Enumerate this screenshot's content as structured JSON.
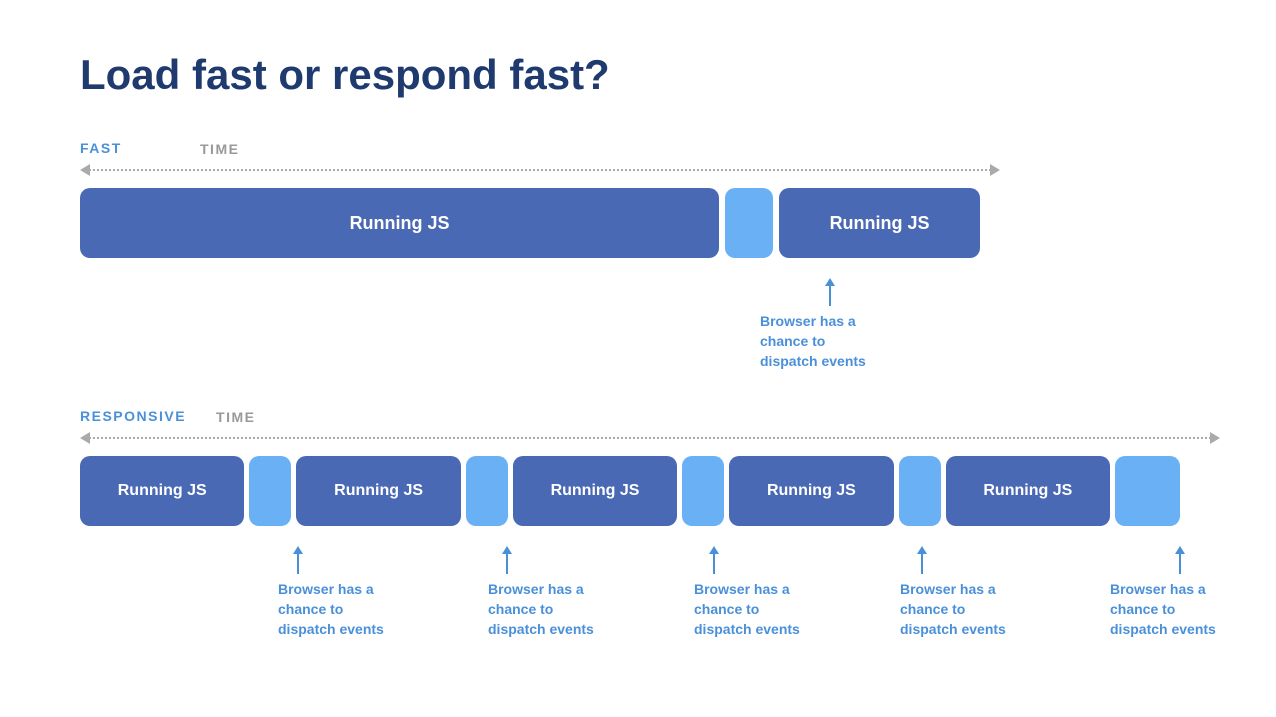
{
  "title": "Load fast or respond fast?",
  "fast_section": {
    "label": "FAST",
    "time_label": "TIME",
    "running_js_label": "Running JS",
    "running_js_label2": "Running JS",
    "annotation": "Browser has a\nchance to\ndispatch events"
  },
  "responsive_section": {
    "label": "RESPONSIVE",
    "time_label": "TIME",
    "running_js_label": "Running JS",
    "annotations": [
      "Browser has a\nchance to\ndispatch events",
      "Browser has a\nchance to\ndispatch events",
      "Browser has a\nchance to\ndispatch events",
      "Browser has a\nchance to\ndispatch events",
      "Browser has a\nchance to\ndispatch events"
    ]
  }
}
